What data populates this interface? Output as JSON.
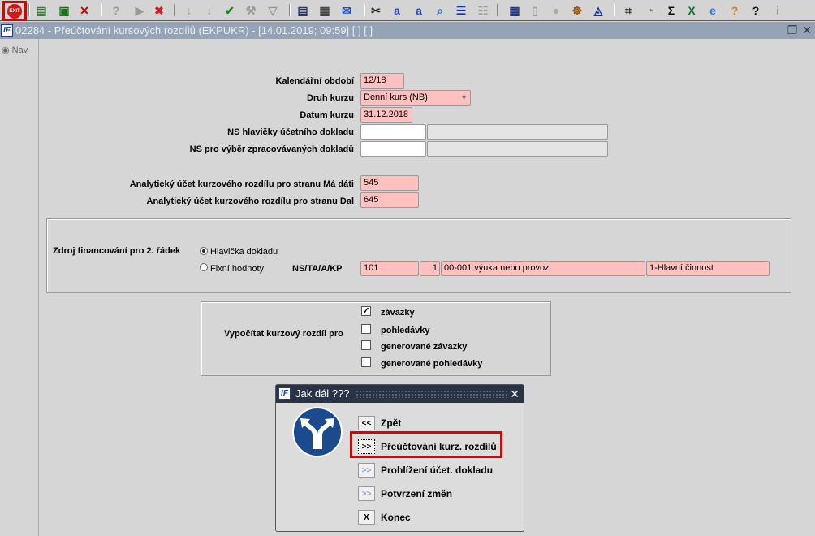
{
  "toolbar": {
    "exit_label": "EXIT",
    "icons": [
      {
        "name": "exit-icon"
      },
      {
        "name": "add-record-icon",
        "glyph": "▤",
        "color": "#2a8a2a"
      },
      {
        "name": "copy-record-icon",
        "glyph": "▣",
        "color": "#117711"
      },
      {
        "name": "delete-record-icon",
        "glyph": "✕",
        "color": "#cc0000"
      },
      {
        "name": "query-icon",
        "glyph": "?",
        "color": "#999999"
      },
      {
        "name": "execute-query-icon",
        "glyph": "▶",
        "color": "#999999"
      },
      {
        "name": "cancel-query-icon",
        "glyph": "✖",
        "color": "#cc2222"
      },
      {
        "name": "sort-ascending-icon",
        "glyph": "↓",
        "color": "#999999"
      },
      {
        "name": "sort-descending-icon",
        "glyph": "↓",
        "color": "#999999"
      },
      {
        "name": "commit-check-icon",
        "glyph": "✔",
        "color": "#118811"
      },
      {
        "name": "wrench-icon",
        "glyph": "⚒",
        "color": "#999999"
      },
      {
        "name": "filter-icon",
        "glyph": "▽",
        "color": "#999999"
      },
      {
        "name": "print-icon",
        "glyph": "▤",
        "color": "#223388"
      },
      {
        "name": "print-multiple-icon",
        "glyph": "▦",
        "color": "#444444"
      },
      {
        "name": "mail-icon",
        "glyph": "✉",
        "color": "#1155cc"
      },
      {
        "name": "scissors-icon",
        "glyph": "✂",
        "color": "#222222"
      },
      {
        "name": "replace-text-icon",
        "glyph": "a",
        "color": "#2244cc"
      },
      {
        "name": "replace-swap-icon",
        "glyph": "a",
        "color": "#2244cc"
      },
      {
        "name": "search-magnifier-icon",
        "glyph": "⌕",
        "color": "#2277cc"
      },
      {
        "name": "list-indent-icon",
        "glyph": "☰",
        "color": "#1133aa"
      },
      {
        "name": "tree-list-icon",
        "glyph": "☷",
        "color": "#999999"
      },
      {
        "name": "form-calculator-icon",
        "glyph": "▦",
        "color": "#223388"
      },
      {
        "name": "document-icon",
        "glyph": "▯",
        "color": "#999999"
      },
      {
        "name": "globe-icon",
        "glyph": "●",
        "color": "#aaaaaa"
      },
      {
        "name": "ship-wheel-icon",
        "glyph": "☸",
        "color": "#995511"
      },
      {
        "name": "eye-triangle-icon",
        "glyph": "◬",
        "color": "#1133aa"
      },
      {
        "name": "chart-icon",
        "glyph": "⌗",
        "color": "#333333"
      },
      {
        "name": "clock-icon",
        "glyph": "◔",
        "color": "#777777"
      },
      {
        "name": "sum-icon",
        "glyph": "Σ",
        "color": "#111111"
      },
      {
        "name": "excel-icon",
        "glyph": "X",
        "color": "#117733"
      },
      {
        "name": "internet-explorer-icon",
        "glyph": "e",
        "color": "#2277dd"
      },
      {
        "name": "help-context-icon",
        "glyph": "?",
        "color": "#cc8822"
      },
      {
        "name": "help-icon",
        "glyph": "?",
        "color": "#111111"
      },
      {
        "name": "info-icon",
        "glyph": "i",
        "color": "#999999"
      }
    ]
  },
  "window": {
    "logo": "IF",
    "title": "02284 - Přeúčtování kursových rozdílů (EKPUKR) - [14.01.2019; 09:59]  [ ]  [ ]",
    "nav_tab": "Nav"
  },
  "form": {
    "kalendarni_obdobi": {
      "label": "Kalendářní období",
      "value": "12/18"
    },
    "druh_kurzu": {
      "label": "Druh kurzu",
      "value": "Denní kurs (NB)"
    },
    "datum_kurzu": {
      "label": "Datum kurzu",
      "value": "31.12.2018"
    },
    "ns_hlavicky": {
      "label": "NS hlavičky účetního dokladu",
      "value": "",
      "desc": ""
    },
    "ns_vyber": {
      "label": "NS pro výběr zpracovávaných dokladů",
      "value": "",
      "desc": ""
    },
    "ucet_ma_dati": {
      "label": "Analytický účet kurzového rozdílu pro stranu Má dáti",
      "value": "545"
    },
    "ucet_dal": {
      "label": "Analytický účet kurzového rozdílu pro stranu Dal",
      "value": "645"
    },
    "zdroj": {
      "label": "Zdroj financování pro 2. řádek",
      "options": [
        {
          "label": "Hlavička dokladu",
          "selected": true
        },
        {
          "label": "Fixní hodnoty",
          "selected": false
        }
      ],
      "ns_label": "NS/TA/A/KP",
      "ns": "101",
      "ta": "1",
      "a": "00-001 výuka nebo provoz",
      "kp": "1-Hlavní činnost"
    },
    "vypocitat": {
      "label": "Vypočítat kurzový rozdíl pro",
      "items": [
        {
          "label": "závazky",
          "checked": true
        },
        {
          "label": "pohledávky",
          "checked": false
        },
        {
          "label": "generované závazky",
          "checked": false
        },
        {
          "label": "generované pohledávky",
          "checked": false
        }
      ]
    }
  },
  "dialog": {
    "title": "Jak dál ???",
    "close": "✕",
    "buttons": [
      {
        "btn": "<<",
        "label": "Zpět",
        "enabled": true
      },
      {
        "btn": ">>",
        "label": "Přeúčtování kurz. rozdílů",
        "enabled": true,
        "highlighted": true
      },
      {
        "btn": ">>",
        "label": "Prohlížení účet. dokladu",
        "enabled": false
      },
      {
        "btn": ">>",
        "label": "Potvrzení změn",
        "enabled": false
      },
      {
        "btn": "X",
        "label": "Konec",
        "enabled": true
      }
    ]
  }
}
